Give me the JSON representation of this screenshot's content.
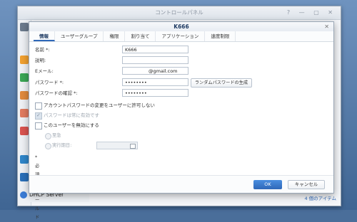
{
  "window": {
    "title": "コントロールパネル",
    "controls": "? — ▢ ✕"
  },
  "sidebar": {
    "dhcp_label": "DHCP Server"
  },
  "status": {
    "item_count": "4 個のアイテム"
  },
  "dialog": {
    "title": "K666",
    "close": "✕",
    "tabs": [
      "情報",
      "ユーザーグループ",
      "権限",
      "割り当て",
      "アプリケーション",
      "速度制限"
    ],
    "fields": {
      "name_label": "名前 *:",
      "name_value": "K666",
      "description_label": "説明:",
      "description_value": "",
      "email_label": "Eメール:",
      "email_value": "@gmail.com",
      "password_label": "パスワード *:",
      "password_value": "••••••••",
      "confirm_label": "パスワードの確認 *:",
      "confirm_value": "••••••••",
      "random_password_button": "ランダムパスワードの生成"
    },
    "options": {
      "disallow_change": "アカウントパスワードの変更をユーザーに許可しない",
      "always_valid": "パスワードは常に有効です",
      "disable_user": "このユーザーを無効にする",
      "radio_now": "至急",
      "radio_date": "実行期日:",
      "date_value": ""
    },
    "required_note": "* 必須フィールド",
    "buttons": {
      "ok": "OK",
      "cancel": "キャンセル"
    }
  }
}
